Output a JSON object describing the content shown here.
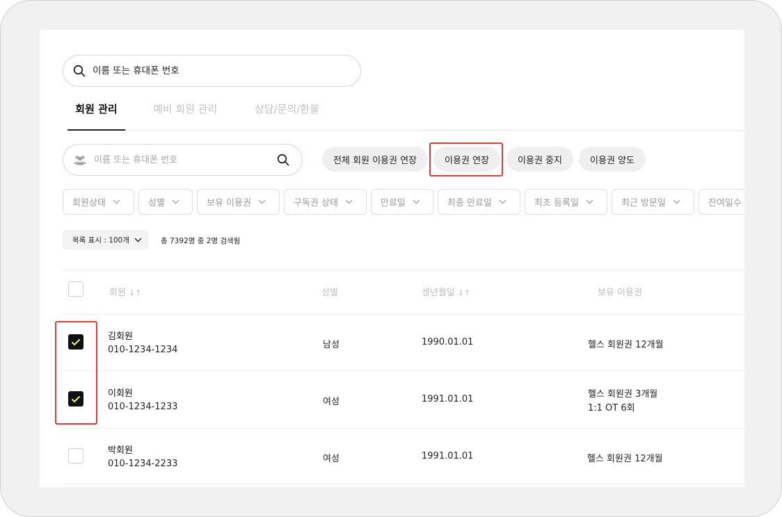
{
  "top_search": {
    "placeholder": "이름 또는 휴대폰 번호"
  },
  "tabs": [
    {
      "label": "회원 관리",
      "active": true
    },
    {
      "label": "예비 회원 관리",
      "active": false
    },
    {
      "label": "상담/문의/환불",
      "active": false
    }
  ],
  "member_search": {
    "placeholder": "이름 또는 휴대폰 번호"
  },
  "actions": {
    "extend_all": "전체 회원 이용권 연장",
    "extend": "이용권 연장",
    "pause": "이용권 중지",
    "transfer": "이용권 양도"
  },
  "filters": [
    "회원상태",
    "성별",
    "보유 이용권",
    "구독권 상태",
    "만료일",
    "최종 만료일",
    "최초 등록일",
    "최근 방문일",
    "잔여일수"
  ],
  "list": {
    "size_label": "목록 표시 : 100개",
    "result": "총 7392명 중 2명 검색됨"
  },
  "table": {
    "headers": {
      "member": "회원",
      "gender": "성별",
      "birth": "생년월일",
      "pass": "보유 이용권",
      "sort_glyph": "↓↑"
    },
    "rows": [
      {
        "name": "김회원",
        "phone": "010-1234-1234",
        "gender": "남성",
        "birth": "1990.01.01",
        "passes": [
          "헬스 회원권 12개월"
        ],
        "checked": true
      },
      {
        "name": "이회원",
        "phone": "010-1234-1233",
        "gender": "여성",
        "birth": "1991.01.01",
        "passes": [
          "헬스 회원권 3개월",
          "1:1 OT 6회"
        ],
        "checked": true
      },
      {
        "name": "박회원",
        "phone": "010-1234-2233",
        "gender": "여성",
        "birth": "1991.01.01",
        "passes": [
          "헬스 회원권 12개월"
        ],
        "checked": false
      }
    ]
  },
  "colors": {
    "highlight": "#e53935",
    "check_mark": "#f4f47a",
    "checkbox_fill": "#111111"
  },
  "icons": {
    "search": "search-icon",
    "people": "people-icon",
    "chevron": "chevron-down-icon",
    "check": "check-icon"
  }
}
